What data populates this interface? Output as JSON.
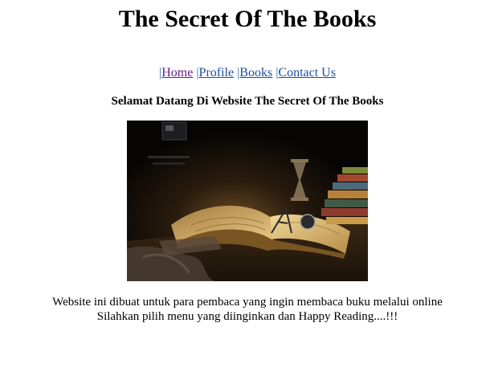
{
  "header": {
    "title": "The Secret Of The Books"
  },
  "nav": {
    "separator": "|",
    "items": [
      {
        "label": "Home"
      },
      {
        "label": "Profile"
      },
      {
        "label": "Books"
      },
      {
        "label": "Contact Us"
      }
    ]
  },
  "main": {
    "welcome": "Selamat Datang Di Website The Secret Of The Books",
    "image": {
      "icon": "open-book-hourglass-image"
    },
    "description_line1": "Website ini dibuat untuk para pembaca yang ingin membaca buku melalui online",
    "description_line2": "Silahkan pilih menu yang diinginkan dan Happy Reading....!!!"
  }
}
